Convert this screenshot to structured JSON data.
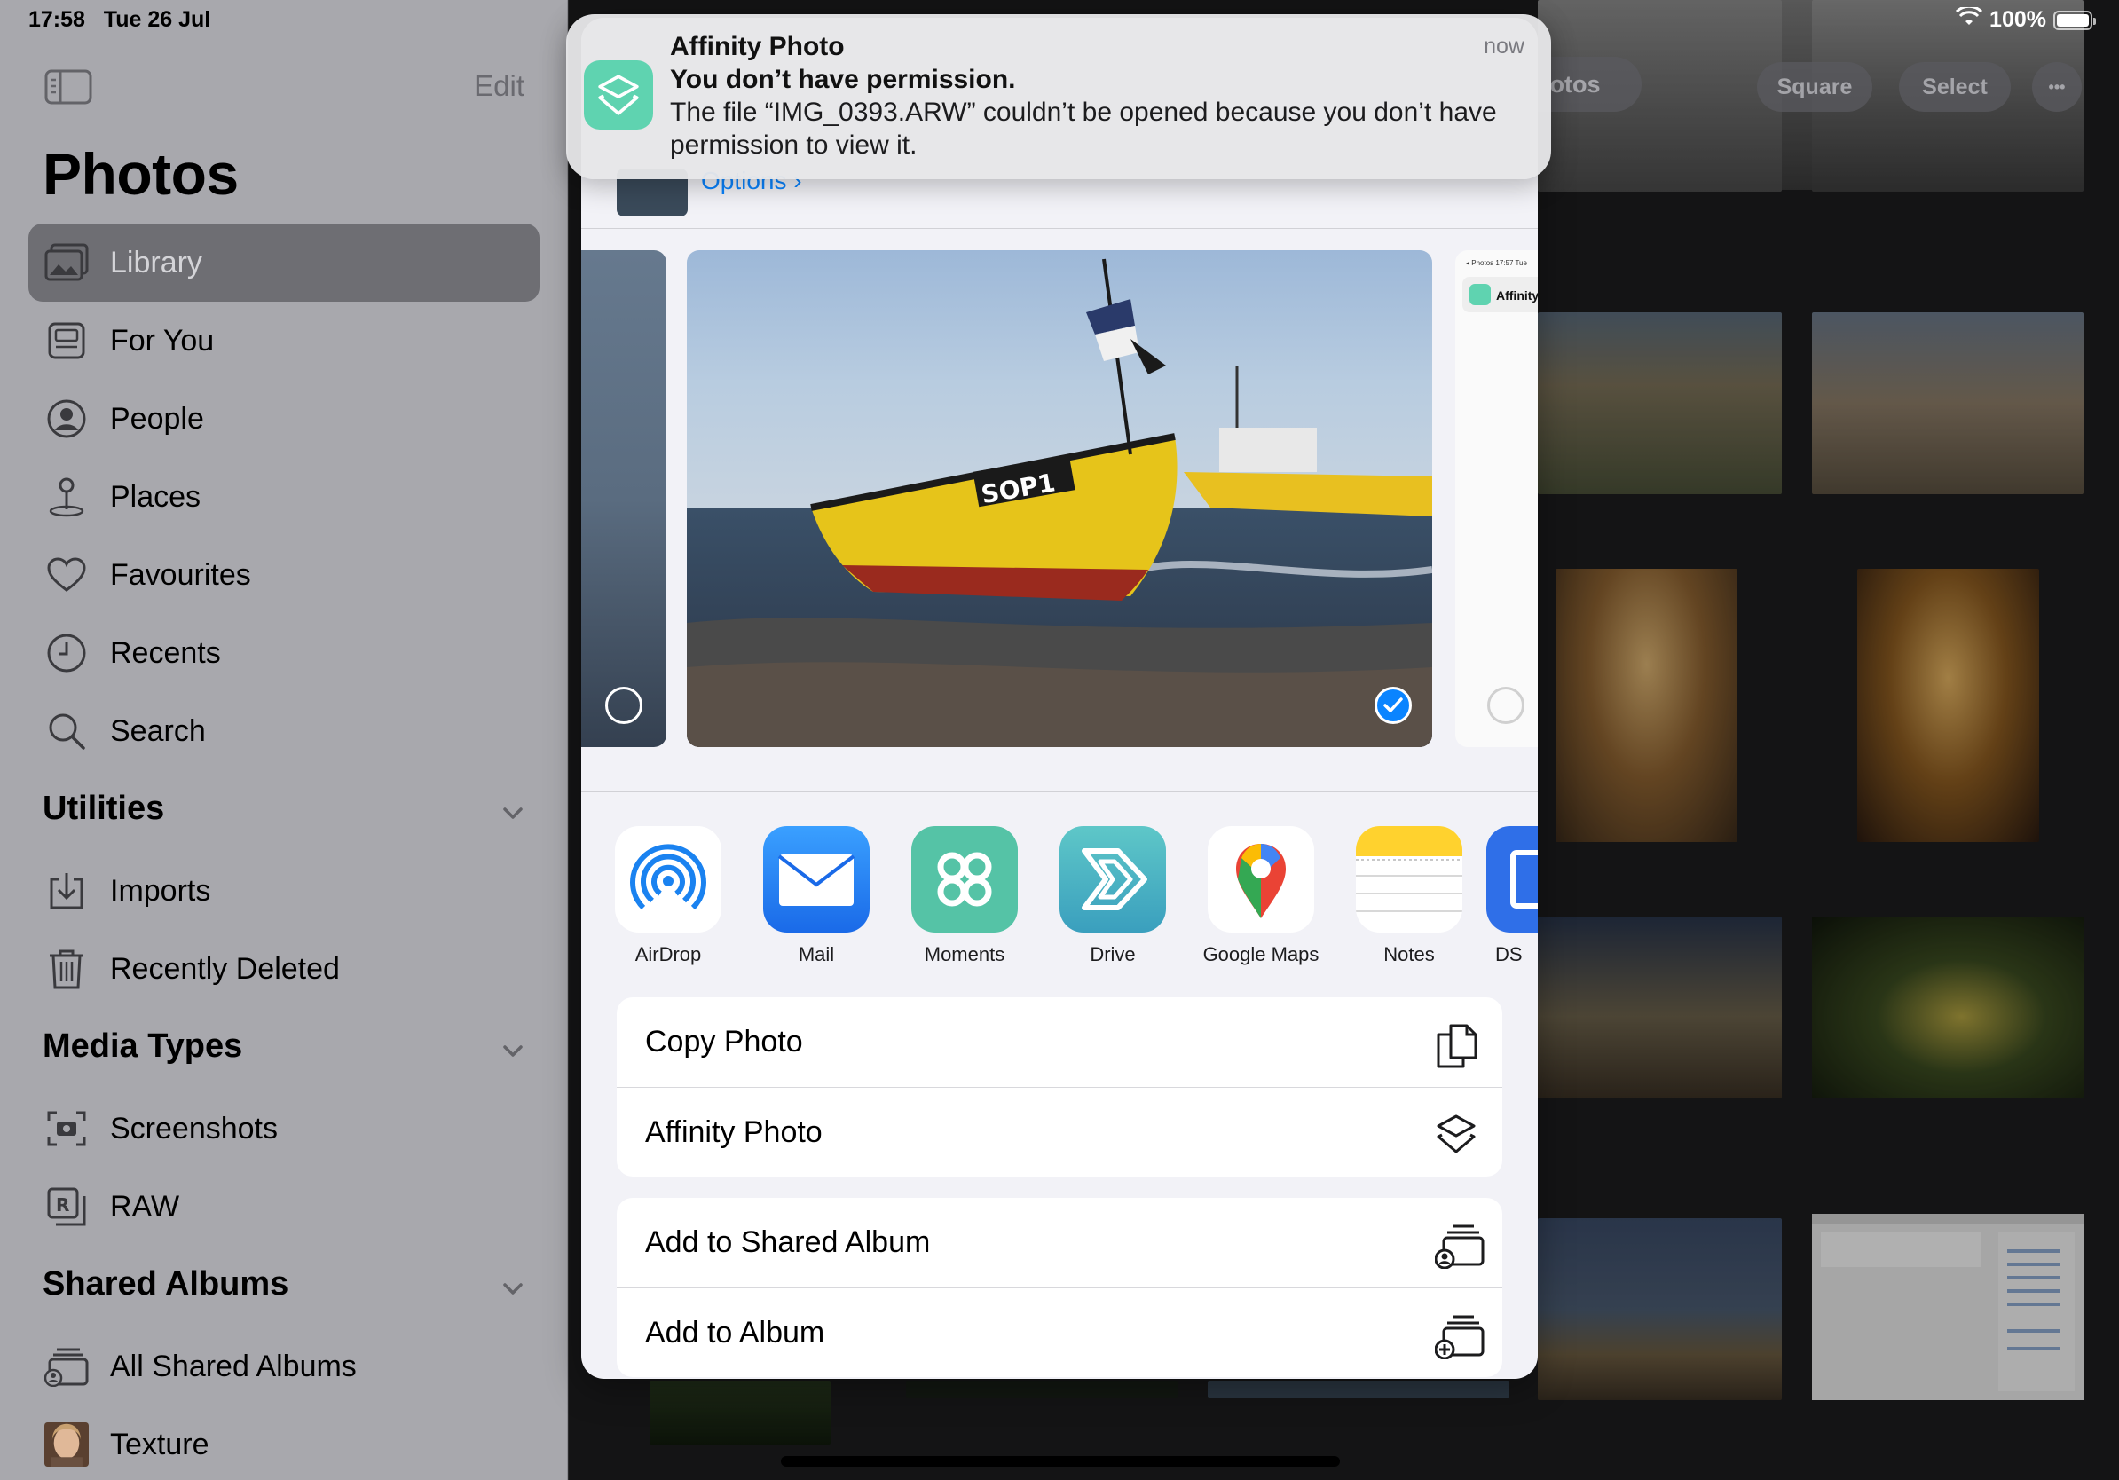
{
  "status_bar": {
    "time": "17:58",
    "date": "Tue 26 Jul",
    "battery": "100%"
  },
  "sidebar": {
    "edit_label": "Edit",
    "title": "Photos",
    "items": [
      {
        "label": "Library",
        "icon": "library-icon",
        "active": true
      },
      {
        "label": "For You",
        "icon": "for-you-icon"
      },
      {
        "label": "People",
        "icon": "people-icon"
      },
      {
        "label": "Places",
        "icon": "places-icon"
      },
      {
        "label": "Favourites",
        "icon": "heart-icon"
      },
      {
        "label": "Recents",
        "icon": "clock-icon"
      },
      {
        "label": "Search",
        "icon": "search-icon"
      }
    ],
    "sections": [
      {
        "title": "Utilities",
        "items": [
          {
            "label": "Imports"
          },
          {
            "label": "Recently Deleted"
          }
        ]
      },
      {
        "title": "Media Types",
        "items": [
          {
            "label": "Screenshots"
          },
          {
            "label": "RAW"
          }
        ]
      },
      {
        "title": "Shared Albums",
        "items": [
          {
            "label": "All Shared Albums"
          },
          {
            "label": "Texture"
          }
        ]
      }
    ]
  },
  "grid": {
    "pills": {
      "photos": "otos",
      "square": "Square",
      "select": "Select",
      "more": "•••"
    }
  },
  "notification": {
    "app": "Affinity Photo",
    "time": "now",
    "title": "You don’t have permission.",
    "body": "The file “IMG_0393.ARW” couldn’t be opened because you don’t have permission to view it."
  },
  "share_sheet": {
    "options_label": "Options",
    "preview_boat_label": "SOP1",
    "preview_screenshot_label": "Affinity",
    "apps": [
      {
        "label": "AirDrop",
        "color": "#ffffff"
      },
      {
        "label": "Mail",
        "color": "#1e7cf0"
      },
      {
        "label": "Moments",
        "color": "#55c3a6"
      },
      {
        "label": "Drive",
        "color": "#4fb3c4"
      },
      {
        "label": "Google Maps",
        "color": "#ffffff"
      },
      {
        "label": "Notes",
        "color": "#ffffff"
      },
      {
        "label": "DS",
        "color": "#2f6fe8"
      }
    ],
    "actions_group1": [
      {
        "label": "Copy Photo",
        "icon": "copy-icon"
      },
      {
        "label": "Affinity Photo",
        "icon": "affinity-icon"
      }
    ],
    "actions_group2": [
      {
        "label": "Add to Shared Album",
        "icon": "shared-album-icon"
      },
      {
        "label": "Add to Album",
        "icon": "add-album-icon"
      }
    ]
  }
}
